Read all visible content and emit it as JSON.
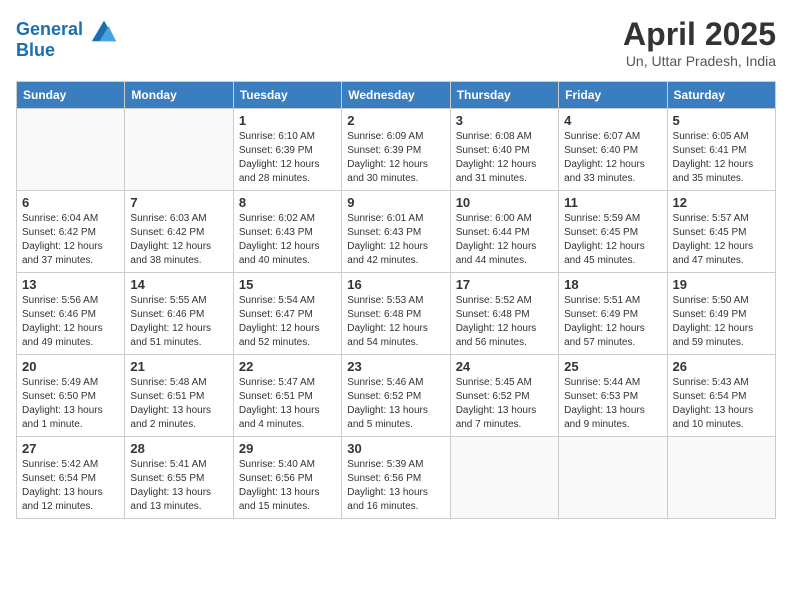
{
  "header": {
    "logo_line1": "General",
    "logo_line2": "Blue",
    "title": "April 2025",
    "subtitle": "Un, Uttar Pradesh, India"
  },
  "days_of_week": [
    "Sunday",
    "Monday",
    "Tuesday",
    "Wednesday",
    "Thursday",
    "Friday",
    "Saturday"
  ],
  "weeks": [
    [
      {
        "day": "",
        "info": ""
      },
      {
        "day": "",
        "info": ""
      },
      {
        "day": "1",
        "info": "Sunrise: 6:10 AM\nSunset: 6:39 PM\nDaylight: 12 hours and 28 minutes."
      },
      {
        "day": "2",
        "info": "Sunrise: 6:09 AM\nSunset: 6:39 PM\nDaylight: 12 hours and 30 minutes."
      },
      {
        "day": "3",
        "info": "Sunrise: 6:08 AM\nSunset: 6:40 PM\nDaylight: 12 hours and 31 minutes."
      },
      {
        "day": "4",
        "info": "Sunrise: 6:07 AM\nSunset: 6:40 PM\nDaylight: 12 hours and 33 minutes."
      },
      {
        "day": "5",
        "info": "Sunrise: 6:05 AM\nSunset: 6:41 PM\nDaylight: 12 hours and 35 minutes."
      }
    ],
    [
      {
        "day": "6",
        "info": "Sunrise: 6:04 AM\nSunset: 6:42 PM\nDaylight: 12 hours and 37 minutes."
      },
      {
        "day": "7",
        "info": "Sunrise: 6:03 AM\nSunset: 6:42 PM\nDaylight: 12 hours and 38 minutes."
      },
      {
        "day": "8",
        "info": "Sunrise: 6:02 AM\nSunset: 6:43 PM\nDaylight: 12 hours and 40 minutes."
      },
      {
        "day": "9",
        "info": "Sunrise: 6:01 AM\nSunset: 6:43 PM\nDaylight: 12 hours and 42 minutes."
      },
      {
        "day": "10",
        "info": "Sunrise: 6:00 AM\nSunset: 6:44 PM\nDaylight: 12 hours and 44 minutes."
      },
      {
        "day": "11",
        "info": "Sunrise: 5:59 AM\nSunset: 6:45 PM\nDaylight: 12 hours and 45 minutes."
      },
      {
        "day": "12",
        "info": "Sunrise: 5:57 AM\nSunset: 6:45 PM\nDaylight: 12 hours and 47 minutes."
      }
    ],
    [
      {
        "day": "13",
        "info": "Sunrise: 5:56 AM\nSunset: 6:46 PM\nDaylight: 12 hours and 49 minutes."
      },
      {
        "day": "14",
        "info": "Sunrise: 5:55 AM\nSunset: 6:46 PM\nDaylight: 12 hours and 51 minutes."
      },
      {
        "day": "15",
        "info": "Sunrise: 5:54 AM\nSunset: 6:47 PM\nDaylight: 12 hours and 52 minutes."
      },
      {
        "day": "16",
        "info": "Sunrise: 5:53 AM\nSunset: 6:48 PM\nDaylight: 12 hours and 54 minutes."
      },
      {
        "day": "17",
        "info": "Sunrise: 5:52 AM\nSunset: 6:48 PM\nDaylight: 12 hours and 56 minutes."
      },
      {
        "day": "18",
        "info": "Sunrise: 5:51 AM\nSunset: 6:49 PM\nDaylight: 12 hours and 57 minutes."
      },
      {
        "day": "19",
        "info": "Sunrise: 5:50 AM\nSunset: 6:49 PM\nDaylight: 12 hours and 59 minutes."
      }
    ],
    [
      {
        "day": "20",
        "info": "Sunrise: 5:49 AM\nSunset: 6:50 PM\nDaylight: 13 hours and 1 minute."
      },
      {
        "day": "21",
        "info": "Sunrise: 5:48 AM\nSunset: 6:51 PM\nDaylight: 13 hours and 2 minutes."
      },
      {
        "day": "22",
        "info": "Sunrise: 5:47 AM\nSunset: 6:51 PM\nDaylight: 13 hours and 4 minutes."
      },
      {
        "day": "23",
        "info": "Sunrise: 5:46 AM\nSunset: 6:52 PM\nDaylight: 13 hours and 5 minutes."
      },
      {
        "day": "24",
        "info": "Sunrise: 5:45 AM\nSunset: 6:52 PM\nDaylight: 13 hours and 7 minutes."
      },
      {
        "day": "25",
        "info": "Sunrise: 5:44 AM\nSunset: 6:53 PM\nDaylight: 13 hours and 9 minutes."
      },
      {
        "day": "26",
        "info": "Sunrise: 5:43 AM\nSunset: 6:54 PM\nDaylight: 13 hours and 10 minutes."
      }
    ],
    [
      {
        "day": "27",
        "info": "Sunrise: 5:42 AM\nSunset: 6:54 PM\nDaylight: 13 hours and 12 minutes."
      },
      {
        "day": "28",
        "info": "Sunrise: 5:41 AM\nSunset: 6:55 PM\nDaylight: 13 hours and 13 minutes."
      },
      {
        "day": "29",
        "info": "Sunrise: 5:40 AM\nSunset: 6:56 PM\nDaylight: 13 hours and 15 minutes."
      },
      {
        "day": "30",
        "info": "Sunrise: 5:39 AM\nSunset: 6:56 PM\nDaylight: 13 hours and 16 minutes."
      },
      {
        "day": "",
        "info": ""
      },
      {
        "day": "",
        "info": ""
      },
      {
        "day": "",
        "info": ""
      }
    ]
  ]
}
